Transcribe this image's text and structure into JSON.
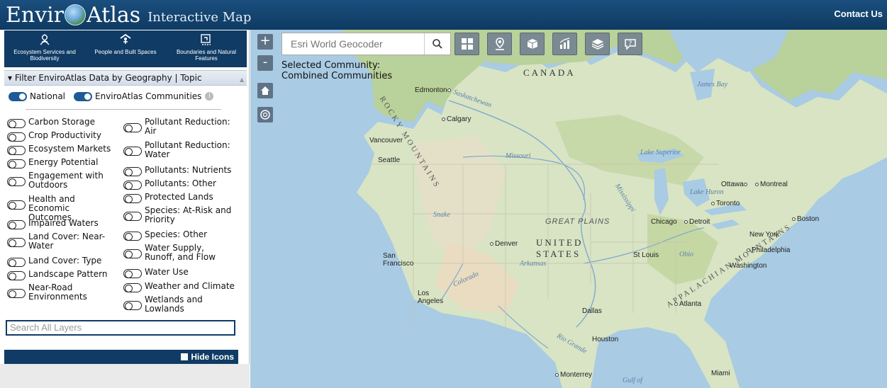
{
  "header": {
    "logo_left": "Envir",
    "logo_right": "Atlas",
    "subtitle": "Interactive Map",
    "contact": "Contact Us"
  },
  "categories": [
    {
      "label": "Ecosystem Services and Biodiversity",
      "icon": "leaf-icon"
    },
    {
      "label": "People and Built Spaces",
      "icon": "person-icon"
    },
    {
      "label": "Boundaries and Natural Features",
      "icon": "boundary-icon"
    }
  ],
  "filter": {
    "header": "Filter EnviroAtlas Data by Geography | Topic",
    "national": "National",
    "communities": "EnviroAtlas Communities",
    "info": "i"
  },
  "topics_col1": [
    "Carbon Storage",
    "Crop Productivity",
    "Ecosystem Markets",
    "Energy Potential",
    "Engagement with Outdoors",
    "Health and Economic Outcomes",
    "Impaired Waters",
    "Land Cover: Near-Water",
    "Land Cover: Type",
    "Landscape Pattern",
    "Near-Road Environments"
  ],
  "topics_col2": [
    "Pollutant Reduction: Air",
    "Pollutant Reduction: Water",
    "Pollutants: Nutrients",
    "Pollutants: Other",
    "Protected Lands",
    "Species: At-Risk and Priority",
    "Species: Other",
    "Water Supply, Runoff, and Flow",
    "Water Use",
    "Weather and Climate",
    "Wetlands and Lowlands"
  ],
  "search": {
    "placeholder": "Search All Layers"
  },
  "hide_icons": "Hide Icons",
  "map": {
    "zoom_in": "+",
    "zoom_out": "-",
    "geocoder_placeholder": "Esri World Geocoder",
    "selected_community_line1": "Selected Community:",
    "selected_community_line2": "Combined Communities",
    "countries": [
      "CANADA",
      "UNITED",
      "STATES"
    ],
    "regions": [
      "GREAT PLAINS"
    ],
    "mountains": [
      "ROCKY MOUNTAINS",
      "APPALACHIAN MOUNTAINS"
    ],
    "water": [
      "Saskatchewan",
      "Missouri",
      "Lake Superior",
      "Lake Huron",
      "Mississippi",
      "Snake",
      "Ohio",
      "Arkansas",
      "Colorado",
      "Rio Grande",
      "Gulf of",
      "James Bay"
    ],
    "cities": {
      "edmonton": "Edmonton",
      "calgary": "Calgary",
      "vancouver": "Vancouver",
      "seattle": "Seattle",
      "ottawa": "Ottawa",
      "montreal": "Montreal",
      "toronto": "Toronto",
      "boston": "Boston",
      "chicago": "Chicago",
      "detroit": "Detroit",
      "newyork": "New York",
      "philadelphia": "Philadelphia",
      "washington": "Washington",
      "denver": "Denver",
      "sanfrancisco1": "San",
      "sanfrancisco2": "Francisco",
      "stlouis": "St Louis",
      "losangeles1": "Los",
      "losangeles2": "Angeles",
      "atlanta": "Atlanta",
      "dallas": "Dallas",
      "houston": "Houston",
      "monterrey": "Monterrey",
      "miami": "Miami"
    }
  },
  "colors": {
    "header_dark": "#0e3a62",
    "panel_nav": "#0f3b64",
    "toggle_on": "#1d5a97",
    "map_water": "#a9cbe3",
    "tool_button": "#7b8a92"
  }
}
